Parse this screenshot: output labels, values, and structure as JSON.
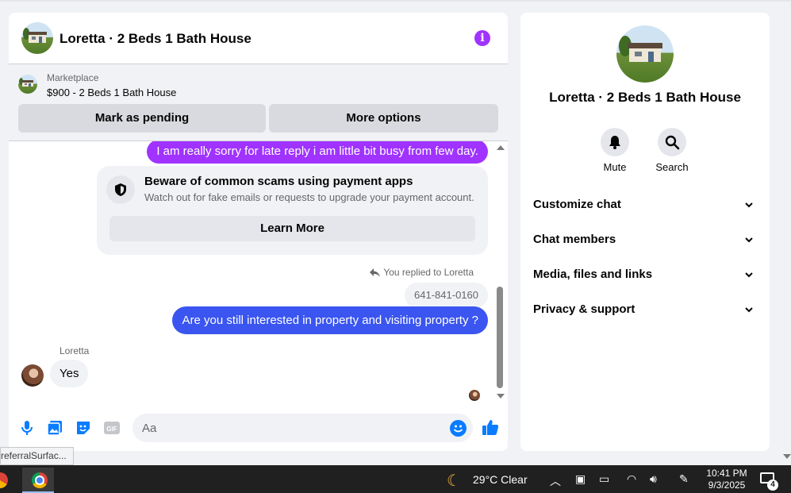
{
  "chat": {
    "title": "Loretta · 2 Beds 1 Bath House",
    "marketplace_label": "Marketplace",
    "listing": "$900 - 2 Beds 1 Bath House",
    "mark_pending_label": "Mark as pending",
    "more_options_label": "More options",
    "messages": {
      "sent_1": "I am really sorry for late reply i am little bit busy from few day.",
      "scam_title": "Beware of common scams using payment apps",
      "scam_text": "Watch out for fake emails or requests to upgrade your payment account.",
      "learn_more_label": "Learn More",
      "replied_note": "You replied to Loretta",
      "quoted": "641-841-0160",
      "sent_2": "Are you still interested in property and visiting property ?",
      "sender_name": "Loretta",
      "received_1": "Yes"
    },
    "composer_placeholder": "Aa",
    "accent_color": "#a033ff",
    "sent_bubble_color": "#3a55f0"
  },
  "info": {
    "title": "Loretta · 2 Beds 1 Bath House",
    "actions": {
      "mute": "Mute",
      "search": "Search"
    },
    "sections": [
      "Customize chat",
      "Chat members",
      "Media, files and links",
      "Privacy & support"
    ]
  },
  "tooltip": "referralSurfac...",
  "taskbar": {
    "weather": "29°C  Clear",
    "time": "10:41 PM",
    "date": "9/3/2025",
    "notifications": "4"
  }
}
